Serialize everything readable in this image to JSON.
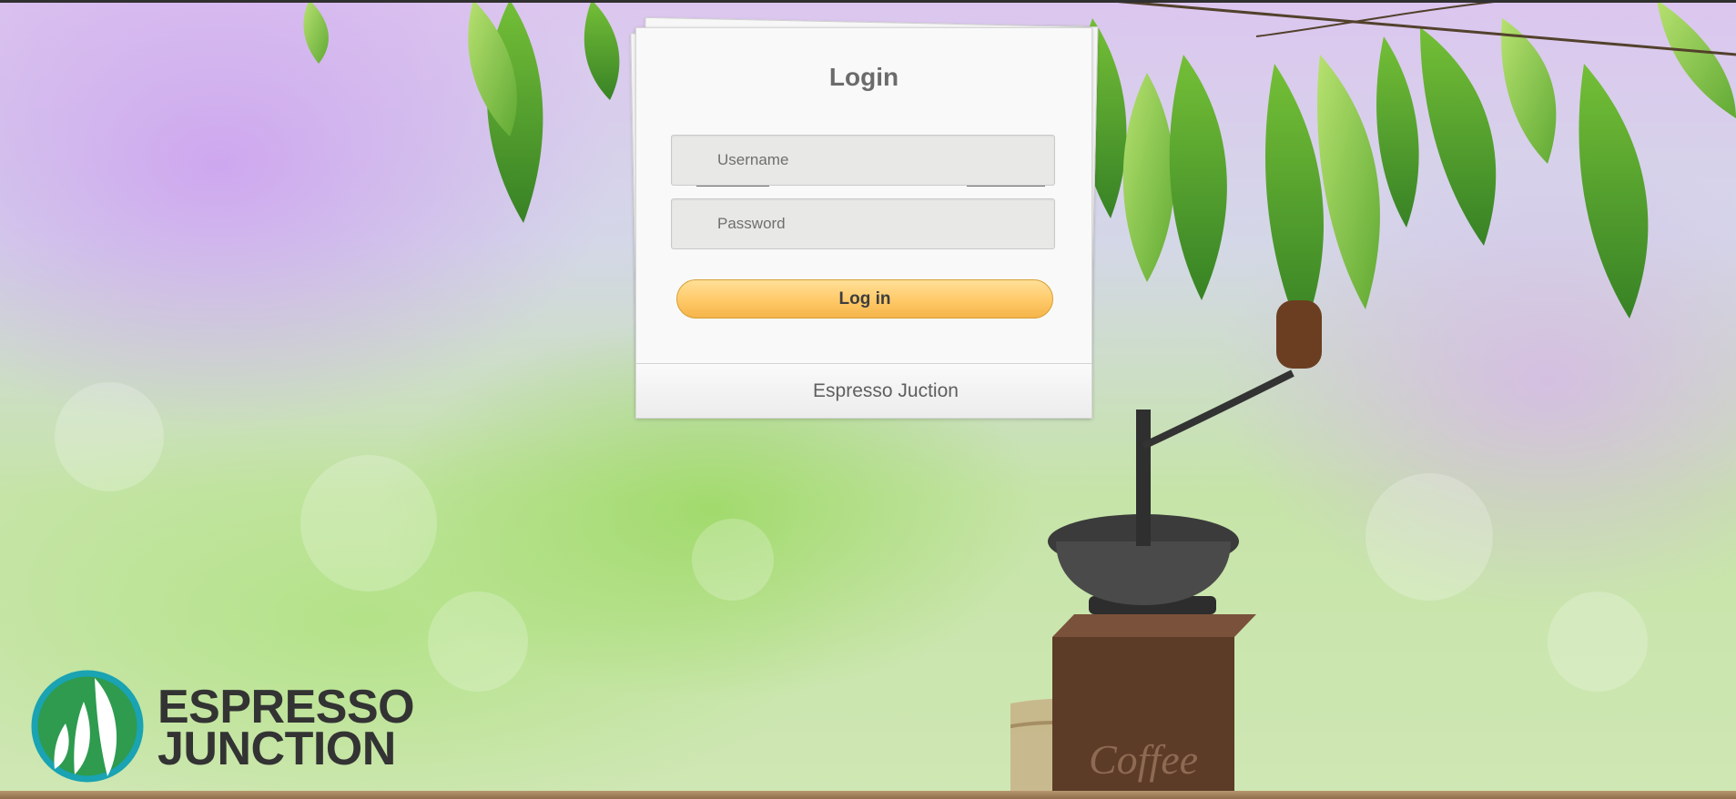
{
  "login": {
    "title": "Login",
    "username_placeholder": "Username",
    "password_placeholder": "Password",
    "submit_label": "Log in",
    "footer_text": "Espresso Juction"
  },
  "brand": {
    "logo_line_1": "ESPRESSO",
    "logo_line_2": "JUNCTION",
    "grinder_text": "Coffee"
  },
  "colors": {
    "button_top": "#ffe097",
    "button_bottom": "#f5b44a",
    "logo_teal": "#1aa3b2",
    "logo_green": "#2e9b4f",
    "logo_text": "#333333"
  },
  "icons": {
    "logo_mark": "leaf-circle-logo"
  }
}
